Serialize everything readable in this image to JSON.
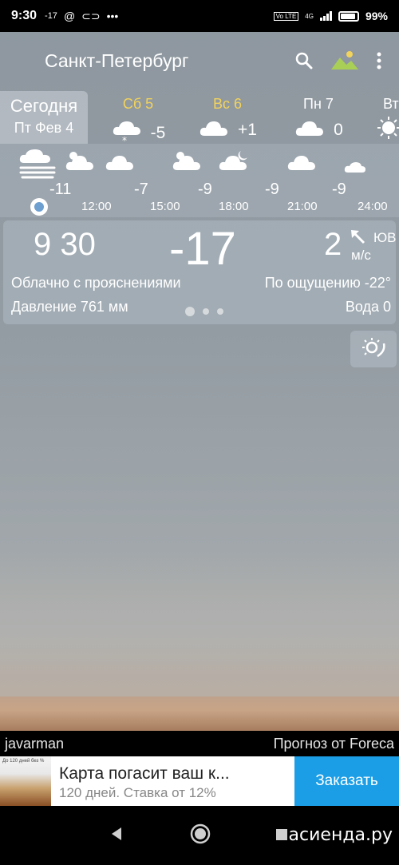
{
  "status_bar": {
    "time": "9:30",
    "temp": "-17",
    "network": "4G",
    "volte": "Vo LTE",
    "battery": "99%"
  },
  "app_bar": {
    "title": "Санкт-Петербург",
    "icons": [
      "search-icon",
      "landscape-icon",
      "more-vert-icon"
    ],
    "accent_color": "#c6dc6a"
  },
  "days": [
    {
      "label": "Сегодня",
      "date": "Пт Фев 4",
      "selected": true
    },
    {
      "label": "Сб 5",
      "temp": "-5",
      "icon": "cloud-snow-icon",
      "color": "#f2d35c"
    },
    {
      "label": "Вс 6",
      "temp": "+1",
      "icon": "cloud-icon",
      "color": "#f2d35c"
    },
    {
      "label": "Пн 7",
      "temp": "0",
      "icon": "cloud-icon",
      "color": "#ffffff"
    },
    {
      "label": "Вт",
      "icon": "sun-icon",
      "color": "#ffffff"
    }
  ],
  "hourly": {
    "icons": [
      "fog-icon",
      "cloud-sun-icon",
      "cloud-icon",
      "cloud-sun-icon",
      "cloud-moon-icon",
      "cloud-icon",
      "moon-cloud-icon"
    ],
    "temps": [
      "-11",
      "-7",
      "-9",
      "-9",
      "-9"
    ],
    "times": [
      "12:00",
      "15:00",
      "18:00",
      "21:00",
      "24:00"
    ]
  },
  "current": {
    "time": "9 30",
    "temp": "-17",
    "wind_speed": "2",
    "wind_unit": "м/с",
    "wind_dir": "ЮВ",
    "condition": "Облачно с прояснениями",
    "feels_like": "По ощущению -22°",
    "pressure": "Давление 761 мм",
    "water": "Вода 0"
  },
  "footer": {
    "photo_author": "javarman",
    "forecast_source": "Прогноз от Foreca"
  },
  "ad": {
    "title": "Карта погасит ваш к...",
    "subtitle": "120 дней. Ставка от 12%",
    "button": "Заказать",
    "thumb_text": "До 120 дней без %",
    "button_color": "#1b9ee6"
  },
  "nav": {
    "watermark": "асиенда.ру"
  }
}
